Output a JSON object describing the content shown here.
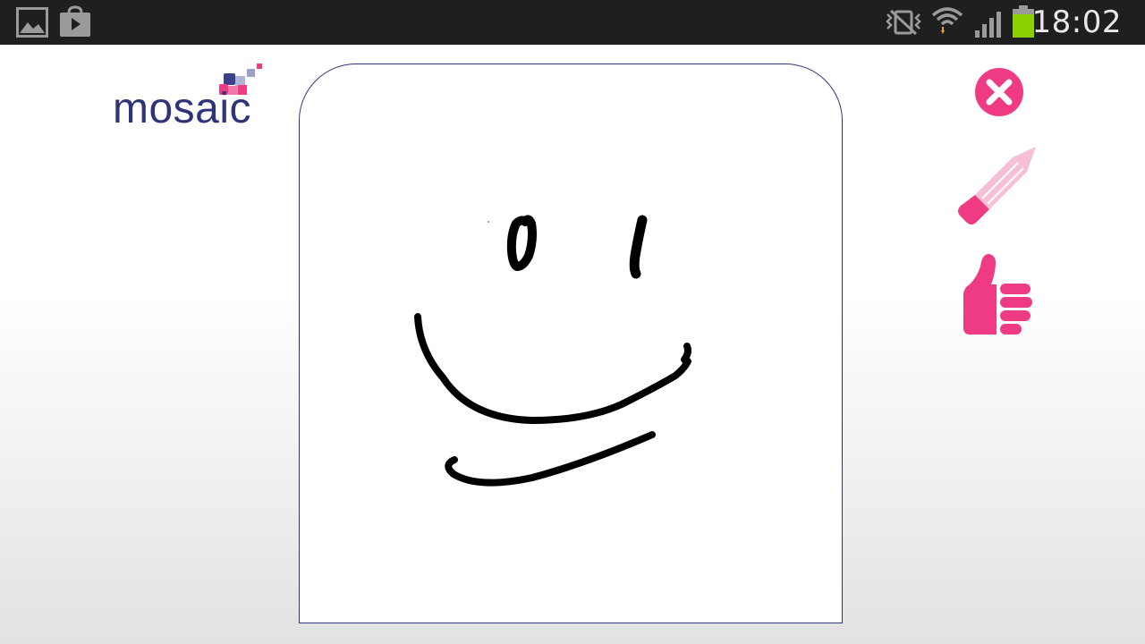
{
  "status_bar": {
    "time": "18:02",
    "icons": [
      "gallery-icon",
      "play-store-icon",
      "vibrate-icon",
      "wifi-icon",
      "signal-icon",
      "battery-icon"
    ]
  },
  "app": {
    "logo_text": "mosaic"
  },
  "colors": {
    "brand_navy": "#2f3478",
    "accent_pink": "#ee3b84",
    "pencil_light": "#f6bfd6",
    "battery_green": "#8bd000",
    "status_bar_bg": "#1f1f1f"
  },
  "tools": [
    "close-icon",
    "pencil-icon",
    "thumbs-up-icon"
  ]
}
